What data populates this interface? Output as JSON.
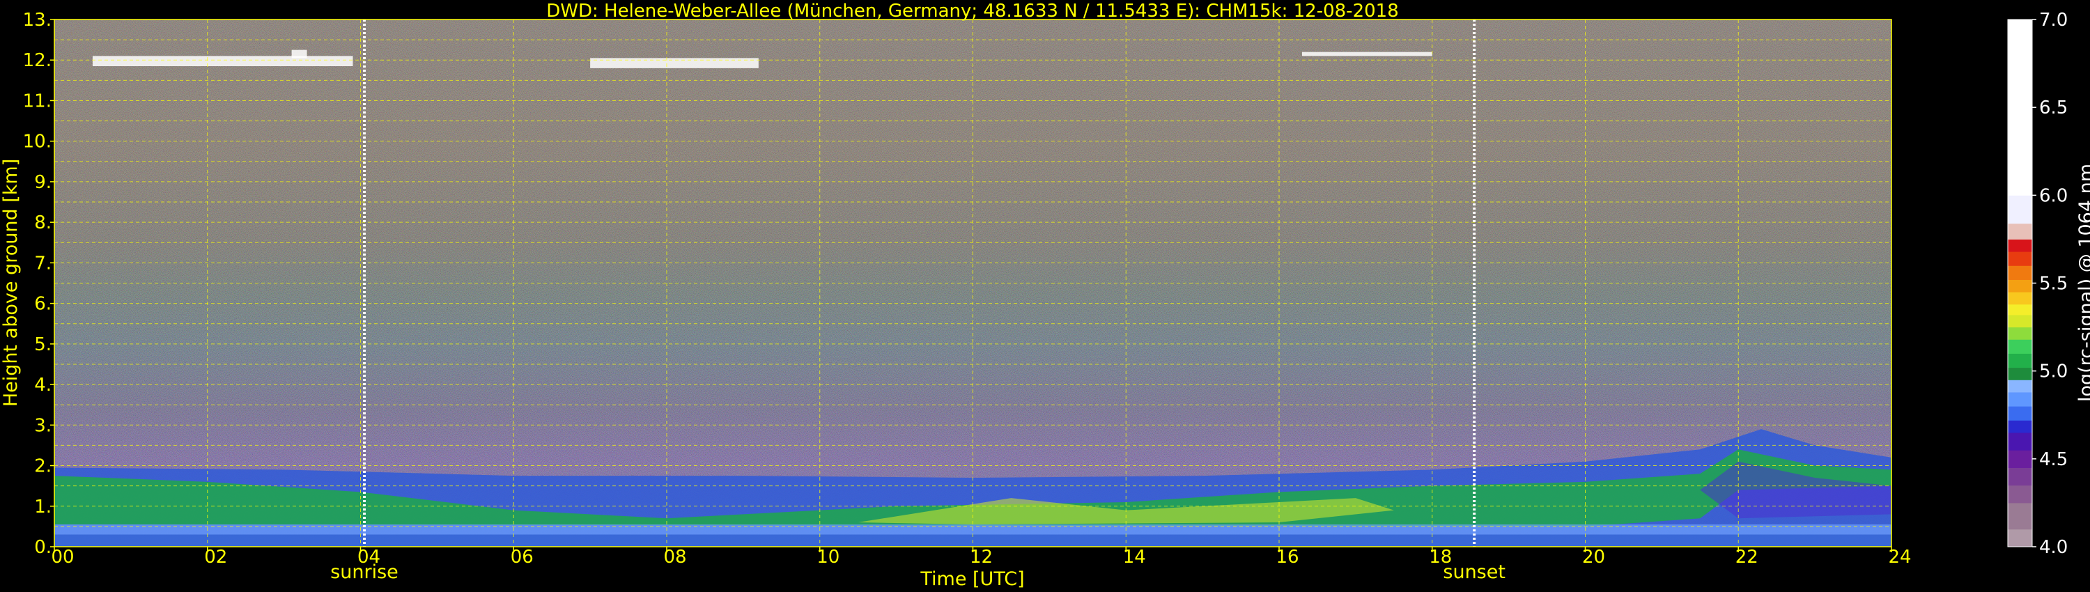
{
  "chart_data": {
    "type": "heatmap",
    "title": "DWD: Helene-Weber-Allee (München, Germany; 48.1633 N / 11.5433 E):    CHM15k: 12-08-2018",
    "xlabel": "Time [UTC]",
    "ylabel": "Height above ground [km]",
    "xlim": [
      0,
      24
    ],
    "ylim": [
      0,
      13
    ],
    "x_ticks": [
      {
        "value": 0,
        "label": "00"
      },
      {
        "value": 2,
        "label": "02"
      },
      {
        "value": 4,
        "label": "04"
      },
      {
        "value": 6,
        "label": "06"
      },
      {
        "value": 8,
        "label": "08"
      },
      {
        "value": 10,
        "label": "10"
      },
      {
        "value": 12,
        "label": "12"
      },
      {
        "value": 14,
        "label": "14"
      },
      {
        "value": 16,
        "label": "16"
      },
      {
        "value": 18,
        "label": "18"
      },
      {
        "value": 20,
        "label": "20"
      },
      {
        "value": 22,
        "label": "22"
      },
      {
        "value": 24,
        "label": "24"
      }
    ],
    "y_ticks": [
      {
        "value": 0,
        "label": "0."
      },
      {
        "value": 1,
        "label": "1."
      },
      {
        "value": 2,
        "label": "2."
      },
      {
        "value": 3,
        "label": "3."
      },
      {
        "value": 4,
        "label": "4."
      },
      {
        "value": 5,
        "label": "5."
      },
      {
        "value": 6,
        "label": "6."
      },
      {
        "value": 7,
        "label": "7."
      },
      {
        "value": 8,
        "label": "8."
      },
      {
        "value": 9,
        "label": "9."
      },
      {
        "value": 10,
        "label": "10."
      },
      {
        "value": 11,
        "label": "11."
      },
      {
        "value": 12,
        "label": "12."
      },
      {
        "value": 13,
        "label": "13."
      }
    ],
    "grid": true,
    "annotations": [
      {
        "label": "sunrise",
        "x": 4.05
      },
      {
        "label": "sunset",
        "x": 18.55
      }
    ],
    "colorbar": {
      "label": "log(rc-signal) @ 1064 nm",
      "range": [
        4.0,
        7.0
      ],
      "ticks": [
        {
          "value": 4.0,
          "label": "4.0"
        },
        {
          "value": 4.5,
          "label": "4.5"
        },
        {
          "value": 5.0,
          "label": "5.0"
        },
        {
          "value": 5.5,
          "label": "5.5"
        },
        {
          "value": 6.0,
          "label": "6.0"
        },
        {
          "value": 6.5,
          "label": "6.5"
        },
        {
          "value": 7.0,
          "label": "7.0"
        }
      ],
      "bands": [
        {
          "from": 4.0,
          "to": 4.1,
          "color": "#b09aa8"
        },
        {
          "from": 4.1,
          "to": 4.25,
          "color": "#9a7b94"
        },
        {
          "from": 4.25,
          "to": 4.35,
          "color": "#8a5a92"
        },
        {
          "from": 4.35,
          "to": 4.45,
          "color": "#7a3d96"
        },
        {
          "from": 4.45,
          "to": 4.55,
          "color": "#6a1f9e"
        },
        {
          "from": 4.55,
          "to": 4.65,
          "color": "#4a16b0"
        },
        {
          "from": 4.65,
          "to": 4.72,
          "color": "#2a2ad0"
        },
        {
          "from": 4.72,
          "to": 4.8,
          "color": "#3a6cf0"
        },
        {
          "from": 4.8,
          "to": 4.88,
          "color": "#5f97ff"
        },
        {
          "from": 4.88,
          "to": 4.95,
          "color": "#8ab6ff"
        },
        {
          "from": 4.95,
          "to": 5.02,
          "color": "#1e8c3c"
        },
        {
          "from": 5.02,
          "to": 5.1,
          "color": "#22b04a"
        },
        {
          "from": 5.1,
          "to": 5.18,
          "color": "#3ccf5c"
        },
        {
          "from": 5.18,
          "to": 5.25,
          "color": "#8edc3c"
        },
        {
          "from": 5.25,
          "to": 5.32,
          "color": "#d6e82a"
        },
        {
          "from": 5.32,
          "to": 5.38,
          "color": "#f4ee2a"
        },
        {
          "from": 5.38,
          "to": 5.45,
          "color": "#f8c81e"
        },
        {
          "from": 5.45,
          "to": 5.52,
          "color": "#f4a012"
        },
        {
          "from": 5.52,
          "to": 5.6,
          "color": "#f07a10"
        },
        {
          "from": 5.6,
          "to": 5.68,
          "color": "#e83c10"
        },
        {
          "from": 5.68,
          "to": 5.75,
          "color": "#d8141a"
        },
        {
          "from": 5.75,
          "to": 5.84,
          "color": "#e8c0b8"
        },
        {
          "from": 5.84,
          "to": 6.0,
          "color": "#f0f0ff"
        },
        {
          "from": 6.0,
          "to": 7.0,
          "color": "#ffffff"
        }
      ]
    }
  },
  "colors": {
    "text_accent": "#ffff00",
    "text_white": "#ffffff",
    "grid": "#ffff00",
    "background": "#000000"
  }
}
